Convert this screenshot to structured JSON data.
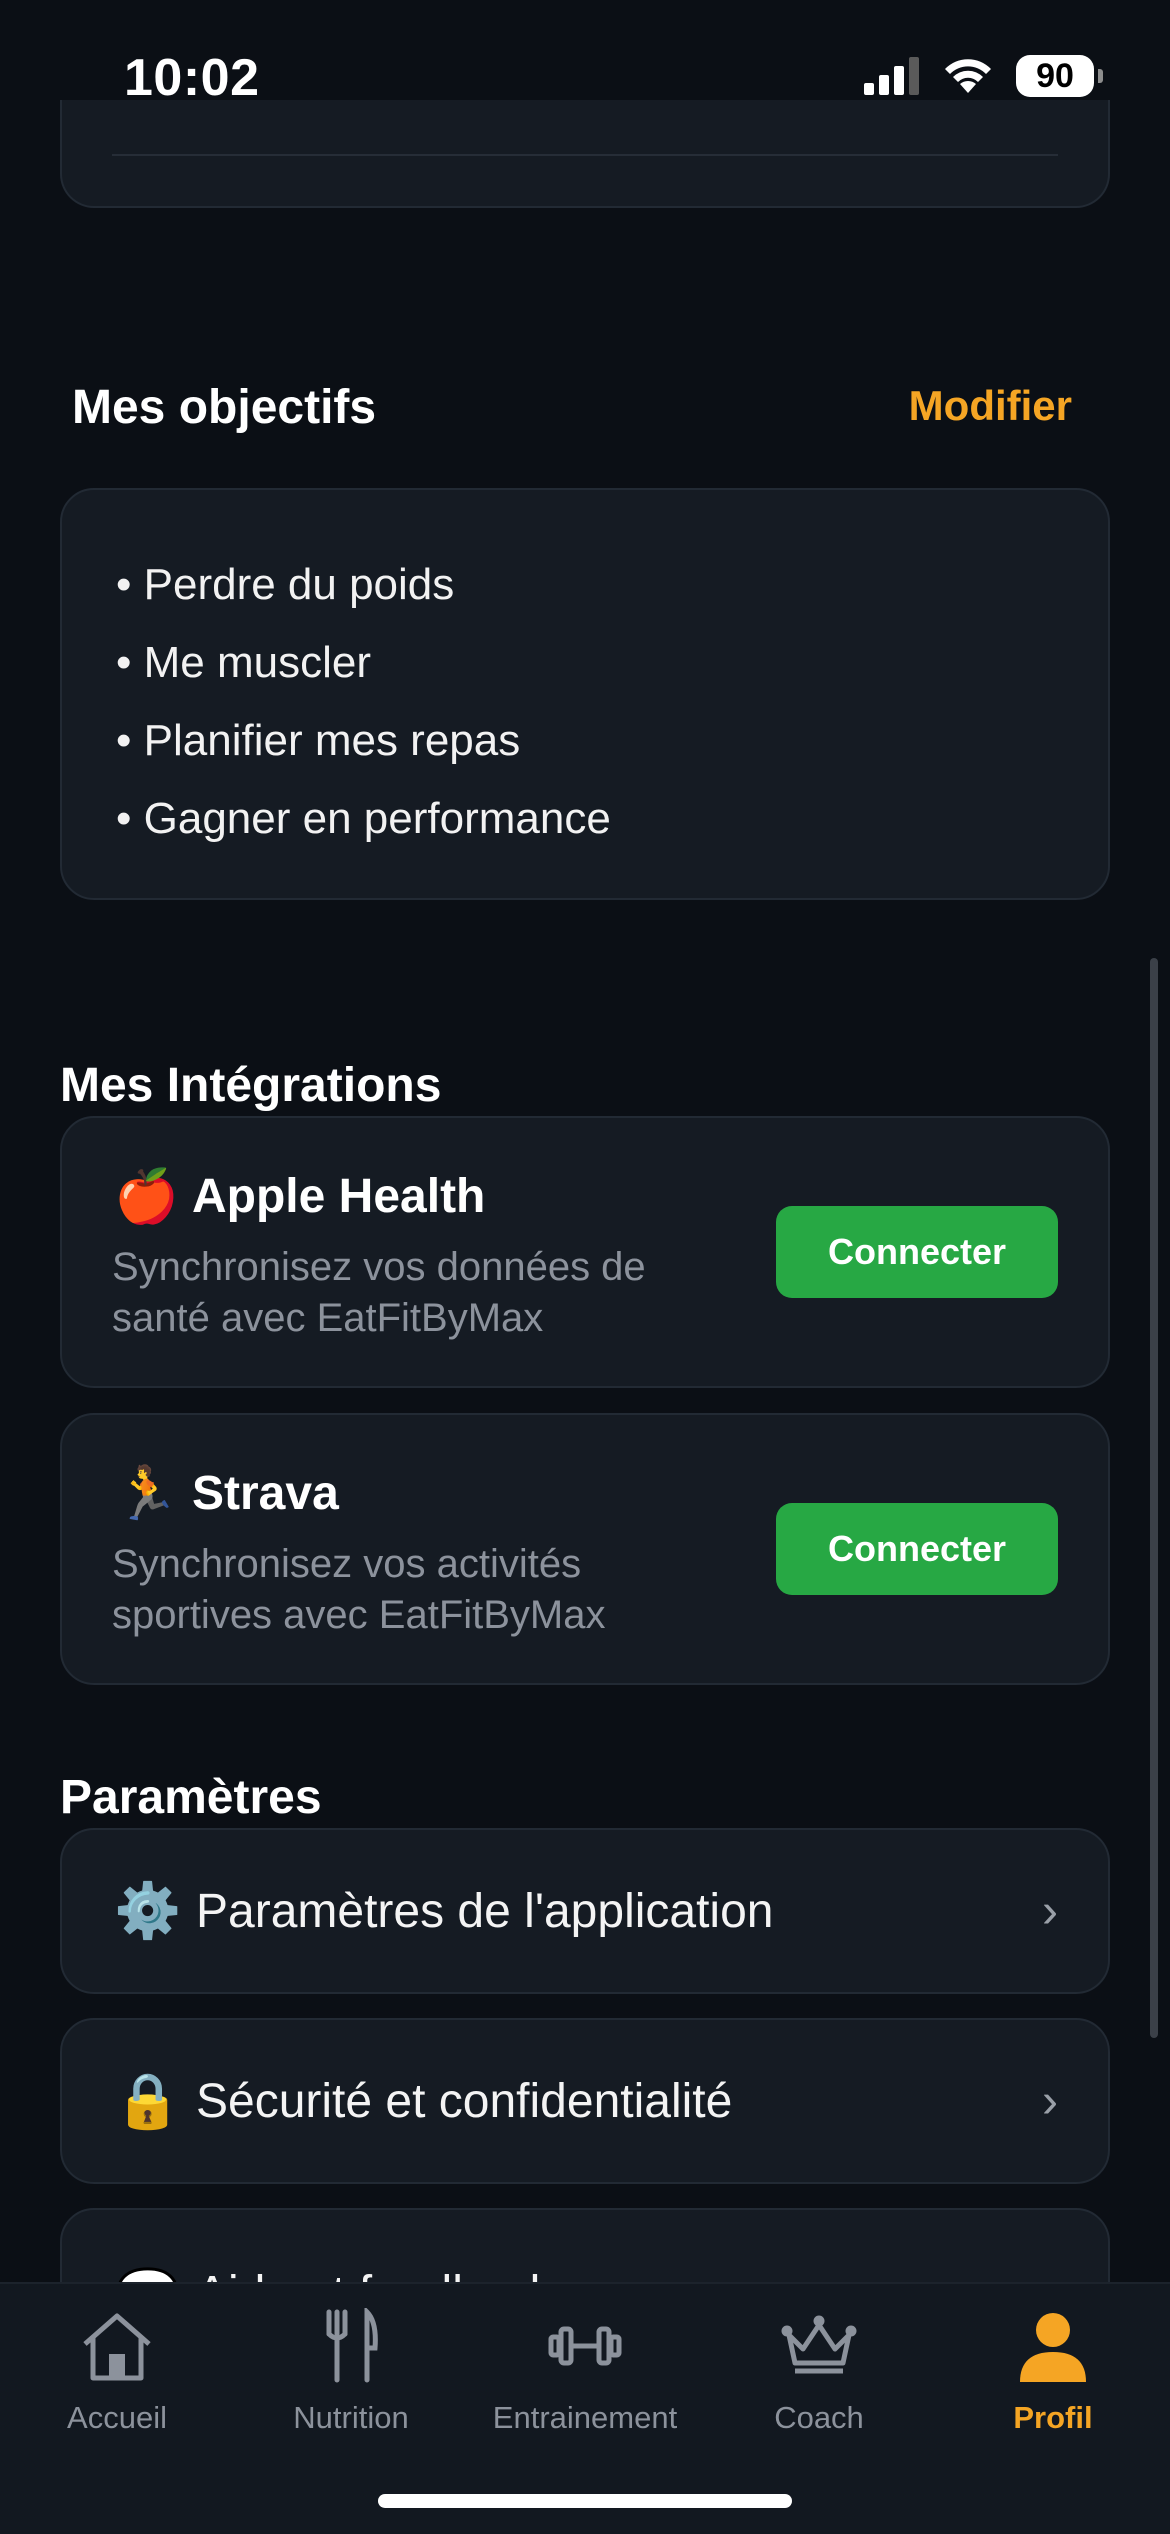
{
  "status_bar": {
    "time": "10:02",
    "battery": "90"
  },
  "goals": {
    "title": "Mes objectifs",
    "edit_label": "Modifier",
    "items": [
      "• Perdre du poids",
      "• Me muscler",
      "• Planifier mes repas",
      "• Gagner en performance"
    ]
  },
  "integrations": {
    "title": "Mes Intégrations",
    "items": [
      {
        "icon": "apple-icon",
        "emoji": "🍎",
        "name": "Apple Health",
        "description": "Synchronisez vos données de santé avec EatFitByMax",
        "button": "Connecter"
      },
      {
        "icon": "runner-icon",
        "emoji": "🏃",
        "name": "Strava",
        "description": "Synchronisez vos activités sportives avec EatFitByMax",
        "button": "Connecter"
      }
    ]
  },
  "settings": {
    "title": "Paramètres",
    "items": [
      {
        "icon": "gear-icon",
        "emoji": "⚙️",
        "label": "Paramètres de l'application"
      },
      {
        "icon": "lock-icon",
        "emoji": "🔒",
        "label": "Sécurité et confidentialité"
      }
    ],
    "partial_item": "Aide et feedback"
  },
  "tabbar": {
    "tabs": [
      {
        "label": "Accueil",
        "icon": "home-icon"
      },
      {
        "label": "Nutrition",
        "icon": "fork-knife-icon"
      },
      {
        "label": "Entrainement",
        "icon": "dumbbell-icon"
      },
      {
        "label": "Coach",
        "icon": "crown-icon"
      },
      {
        "label": "Profil",
        "icon": "person-icon",
        "active": true
      }
    ]
  },
  "colors": {
    "background": "#0b0f15",
    "card": "#151b23",
    "accent": "#f5a524",
    "connect_green": "#27a844"
  }
}
